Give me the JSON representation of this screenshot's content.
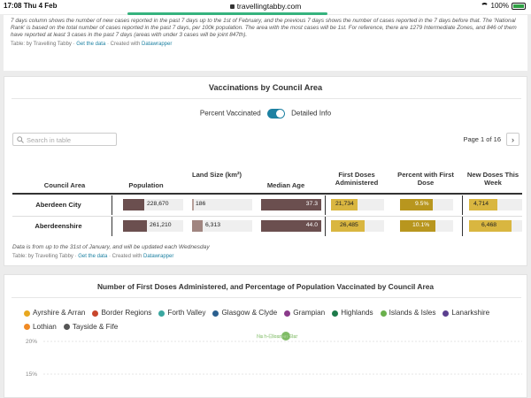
{
  "status": {
    "time": "17:08",
    "day": "Thu 4 Feb",
    "url": "travellingtabby.com",
    "battery": "100%"
  },
  "top_note": "7 days column shows the number of new cases reported in the past 7 days up to the 1st of February, and the previous 7 days shows the number of cases reported in the 7 days before that. The 'National Rank' is based on the total number of cases reported in the past 7 days, per 100k population. The area with the most cases will be 1st. For reference, there are 1279 Intermediate Zones, and 846 of them have reported at least 3 cases in the past 7 days (areas with under 3 cases will be joint 847th).",
  "credit": {
    "prefix": "Table: by Travelling Tabby · ",
    "get_data": "Get the data",
    "middle": " · Created with ",
    "dw": "Datawrapper"
  },
  "vacc": {
    "title": "Vaccinations by Council Area",
    "toggle_left": "Percent Vaccinated",
    "toggle_right": "Detailed Info",
    "search_placeholder": "Search in table",
    "page_label": "Page 1 of 16",
    "columns": {
      "area": "Council Area",
      "pop": "Population",
      "land": "Land Size (km²)",
      "age": "Median Age",
      "first": "First Doses Administered",
      "pct": "Percent with First Dose",
      "new": "New Doses This Week"
    },
    "rows": [
      {
        "area": "Aberdeen City",
        "pop": "228,670",
        "land": "186",
        "age": "37.3",
        "first": "21,734",
        "pct": "9.5%",
        "new": "4,714"
      },
      {
        "area": "Aberdeenshire",
        "pop": "261,210",
        "land": "6,313",
        "age": "44.0",
        "first": "26,485",
        "pct": "10.1%",
        "new": "6,468"
      }
    ],
    "footnote": "Data is from up to the 31st of January, and will be updated each Wednesday"
  },
  "chart_title": "Number of First Doses Administered, and Percentage of Population Vaccinated by Council Area",
  "legend": [
    {
      "label": "Ayrshire & Arran",
      "color": "#e8a820"
    },
    {
      "label": "Border Regions",
      "color": "#c8462c"
    },
    {
      "label": "Forth Valley",
      "color": "#3aa7a0"
    },
    {
      "label": "Glasgow & Clyde",
      "color": "#2a5f8f"
    },
    {
      "label": "Grampian",
      "color": "#8a3a8a"
    },
    {
      "label": "Highlands",
      "color": "#1e7a4a"
    },
    {
      "label": "Islands & Isles",
      "color": "#6ab04c"
    },
    {
      "label": "Lanarkshire",
      "color": "#5b3f8f"
    },
    {
      "label": "Lothian",
      "color": "#f08a24"
    },
    {
      "label": "Tayside & Fife",
      "color": "#555555"
    }
  ],
  "chart_data": {
    "type": "scatter",
    "title": "Number of First Doses Administered, and Percentage of Population Vaccinated by Council Area",
    "y_tick_labels": [
      "20%",
      "15%"
    ],
    "points": [
      {
        "label": "Na h-Eileanan Siar",
        "y": 20,
        "series": "Islands & Isles"
      }
    ]
  }
}
